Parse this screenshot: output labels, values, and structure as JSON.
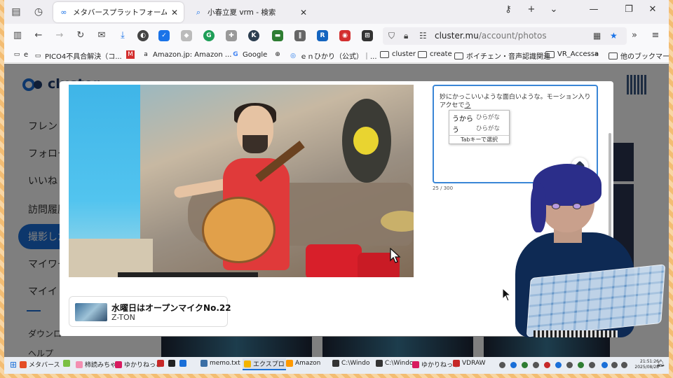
{
  "browser": {
    "tabs": [
      {
        "title": "メタバースプラットフォーム cluster（ク",
        "active": true,
        "icon": "cluster-icon"
      },
      {
        "title": "小春立夏 vrm - 検索",
        "active": false,
        "icon": "search-icon"
      }
    ],
    "url": {
      "host": "cluster.mu",
      "path": "/account/photos"
    },
    "bookmarks": [
      {
        "label": "e",
        "icon": "page-icon"
      },
      {
        "label": "PICO4不具合解決（コ...",
        "icon": "page-icon"
      },
      {
        "label": "",
        "icon": "red-logo-icon"
      },
      {
        "label": "Amazon.jp: Amazon ...",
        "icon": "amazon-icon"
      },
      {
        "label": "Google",
        "icon": "google-icon"
      },
      {
        "label": "",
        "icon": "globe-icon"
      },
      {
        "label": "ｅｎひかり（公式）｜...",
        "icon": "page-icon"
      },
      {
        "label": "cluster",
        "icon": "folder-icon"
      },
      {
        "label": "create",
        "icon": "folder-icon"
      },
      {
        "label": "ボイチェン・音声認識関連",
        "icon": "folder-icon"
      },
      {
        "label": "VR_Accessa",
        "icon": "folder-icon"
      },
      {
        "label": "他のブックマーク",
        "icon": "folder-icon"
      }
    ]
  },
  "page": {
    "logo": "cluster",
    "sidebar": [
      "フレンド",
      "フォロー",
      "いいね",
      "訪問履歴",
      "撮影した",
      "マイワー",
      "マイイ",
      "ダウンロ",
      "ヘルプ"
    ],
    "active_sidebar_index": 4
  },
  "modal": {
    "caption_text": "妙にかっこいいような面白いような。モーション入りアクセでう",
    "caption_underlined": "う",
    "char_counter": "25 / 300",
    "ime_candidates": [
      {
        "text": "うから",
        "hint": "ひらがな"
      },
      {
        "text": "う",
        "hint": "ひらがな"
      }
    ],
    "ime_footer": "Tabキーで選択",
    "world_card": {
      "title": "水曜日はオープンマイクNo.22",
      "owner": "Z-TON"
    }
  },
  "taskbar": {
    "items": [
      {
        "label": "メタバース",
        "color": "#e44d26"
      },
      {
        "label": "",
        "color": "#7bc043"
      },
      {
        "label": "柿読みちゃ",
        "color": "#f48fb1"
      },
      {
        "label": "ゆかりねっこ",
        "color": "#d81b60"
      },
      {
        "label": "",
        "color": "#c62828"
      },
      {
        "label": "",
        "color": "#222222"
      },
      {
        "label": "",
        "color": "#1a6fd8"
      },
      {
        "label": "memo.txt",
        "color": "#3a6ea5"
      },
      {
        "label": "エクスプロ",
        "color": "#f4b400",
        "active": true
      },
      {
        "label": "Amazon",
        "color": "#ff9900"
      },
      {
        "label": "C:\\Windo",
        "color": "#333333"
      },
      {
        "label": "C:\\Windo",
        "color": "#333333"
      },
      {
        "label": "ゆかりねっこ",
        "color": "#d81b60"
      },
      {
        "label": "VDRAW",
        "color": "#c62828"
      }
    ],
    "clock": {
      "time": "21:51:26",
      "date": "2025/08/28"
    }
  },
  "colors": {
    "accent": "#1a6fd8",
    "editor_border": "#3a86d6",
    "navy": "#0e2a54"
  }
}
